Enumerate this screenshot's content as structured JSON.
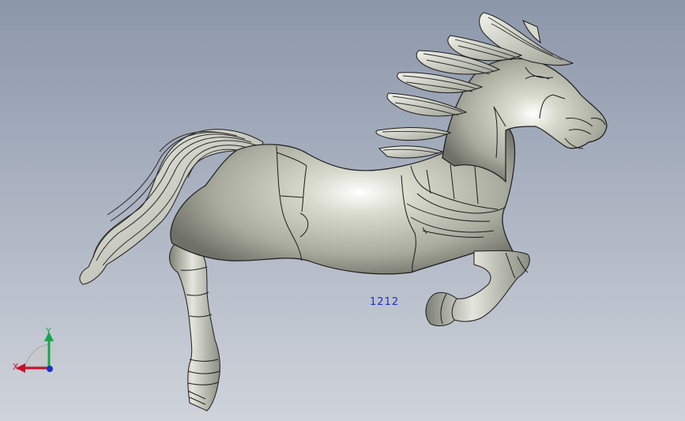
{
  "viewport": {
    "part_label": "1212",
    "colors": {
      "background_top": "#8c97aa",
      "background_bottom": "#cfd3da",
      "model_fill": "#b9bcae",
      "edge": "#1c1c1c",
      "annotation_text": "#1f2fb8"
    }
  },
  "triad": {
    "x_label": "X",
    "y_label": "Y",
    "x_color": "#c8102e",
    "y_color": "#17a64a",
    "z_color": "#1633c7"
  }
}
